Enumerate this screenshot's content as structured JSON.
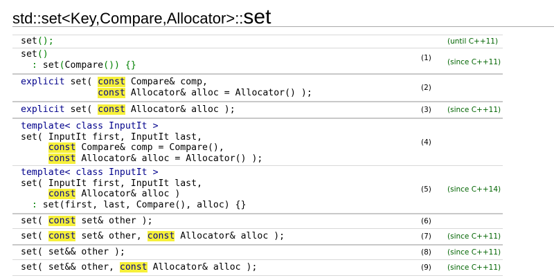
{
  "title": {
    "prefix": "std::set<Key,Compare,Allocator>::",
    "name": "set"
  },
  "decls": [
    {
      "num": "",
      "since": "(until C++11)",
      "lines": [
        [
          "set",
          "();"
        ]
      ]
    },
    {
      "num": "(1)",
      "since": "(since C++11)",
      "lines": [
        [
          "set",
          "()"
        ],
        [
          "  : ",
          "set(Compare()) {}"
        ]
      ]
    },
    {
      "num": "(2)",
      "since": "",
      "lines": [
        [
          "explicit",
          " set( ",
          "const",
          " Compare& comp,"
        ],
        [
          "              ",
          "const",
          " Allocator& alloc = Allocator() );"
        ]
      ]
    },
    {
      "num": "(3)",
      "since": "(since C++11)",
      "lines": [
        [
          "explicit",
          " set( ",
          "const",
          " Allocator& alloc );"
        ]
      ]
    },
    {
      "num": "(4)",
      "since": "",
      "lines": [
        [
          "template<",
          " class ",
          "InputIt >"
        ],
        [
          "set( InputIt first, InputIt last,"
        ],
        [
          "     ",
          "const",
          " Compare& comp = Compare(),"
        ],
        [
          "     ",
          "const",
          " Allocator& alloc = Allocator() );"
        ]
      ]
    },
    {
      "num": "(5)",
      "since": "(since C++14)",
      "lines": [
        [
          "template<",
          " class ",
          "InputIt >"
        ],
        [
          "set( InputIt first, InputIt last,"
        ],
        [
          "     ",
          "const",
          " Allocator& alloc )"
        ],
        [
          "  : ",
          "set(first, last, Compare(), alloc) {}"
        ]
      ]
    },
    {
      "num": "(6)",
      "since": "",
      "lines": [
        [
          "set( ",
          "const",
          " set& other );"
        ]
      ]
    },
    {
      "num": "(7)",
      "since": "(since C++11)",
      "lines": [
        [
          "set( ",
          "const",
          " set& other, ",
          "const",
          " Allocator& alloc );"
        ]
      ]
    },
    {
      "num": "(8)",
      "since": "(since C++11)",
      "lines": [
        [
          "set( set&& other );"
        ]
      ]
    },
    {
      "num": "(9)",
      "since": "(since C++11)",
      "lines": [
        [
          "set( set&& other, ",
          "const",
          " Allocator& alloc );"
        ]
      ]
    }
  ]
}
